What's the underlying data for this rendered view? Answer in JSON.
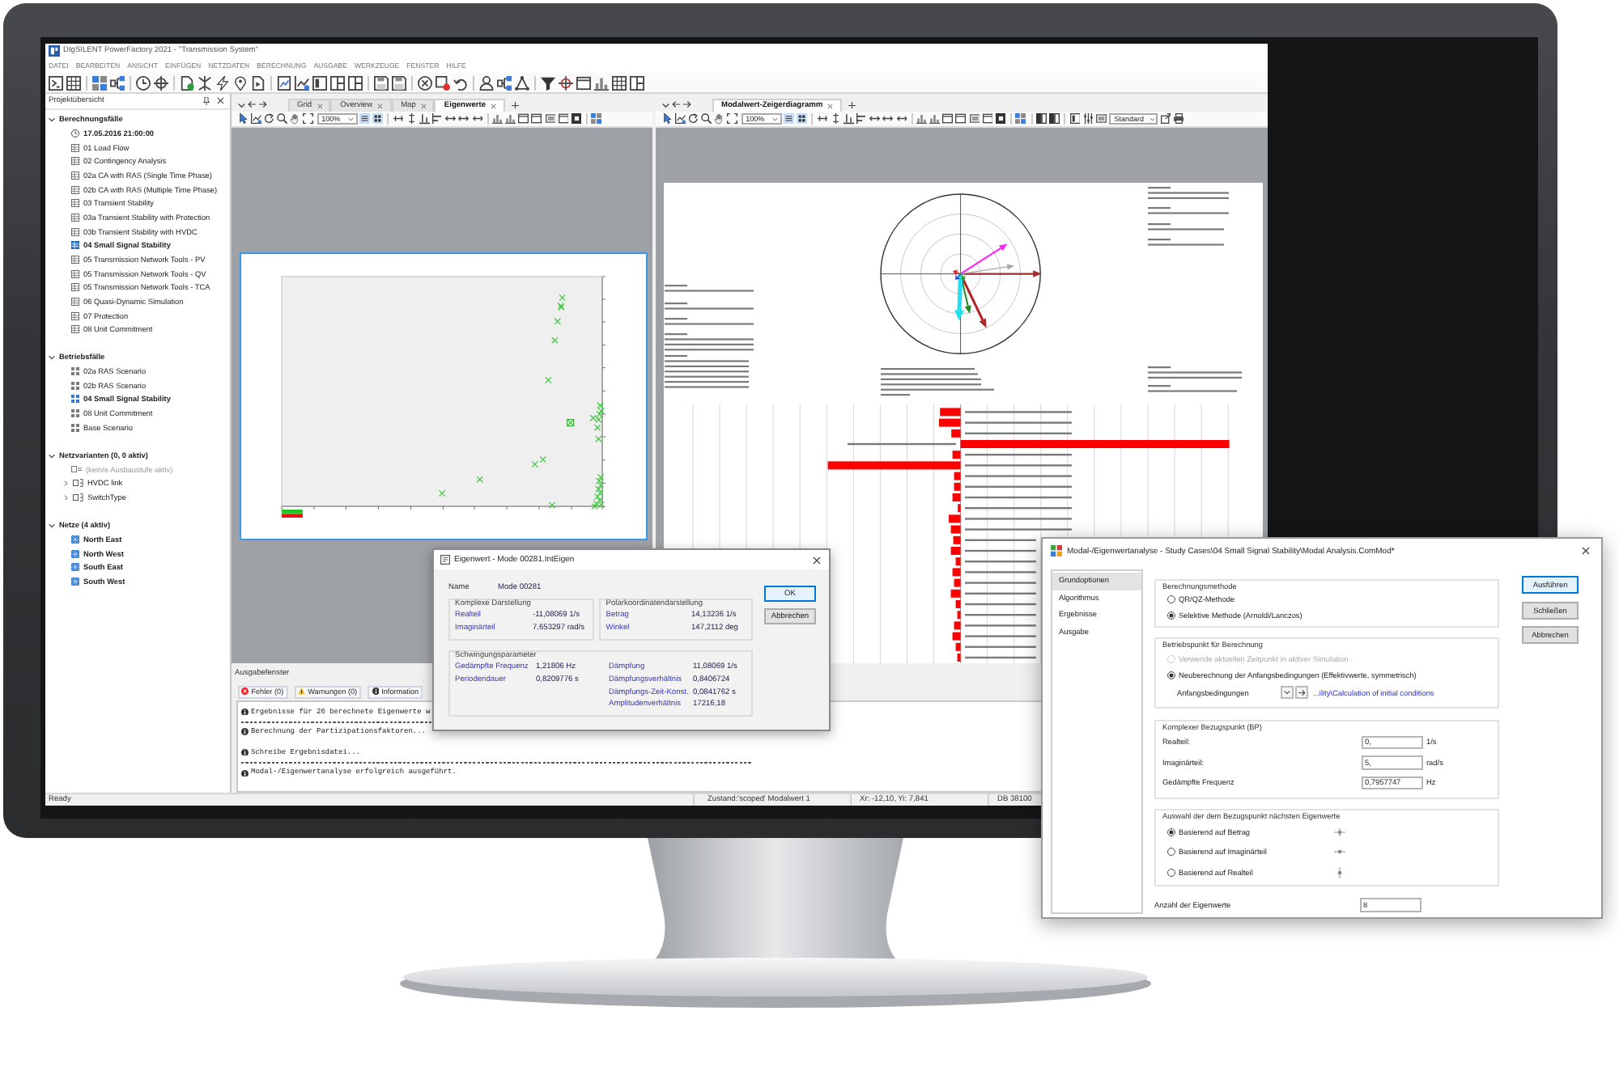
{
  "window": {
    "title": "DIgSILENT PowerFactory 2021 - \"Transmission System\""
  },
  "menu": [
    "DATEI",
    "BEARBEITEN",
    "ANSICHT",
    "EINFÜGEN",
    "NETZDATEN",
    "BERECHNUNG",
    "AUSGABE",
    "WERKZEUGE",
    "FENSTER",
    "HILFE"
  ],
  "project_panel": {
    "title": "Projektübersicht",
    "groups": [
      {
        "label": "Berechnungsfälle",
        "expanded": true,
        "children": [
          {
            "label": "17.05.2016 21:00:00",
            "kind": "time",
            "active": true
          },
          {
            "label": "01 Load Flow",
            "kind": "case",
            "active": false
          },
          {
            "label": "02 Contingency Analysis",
            "kind": "case",
            "active": false
          },
          {
            "label": "02a CA with RAS (Single Time Phase)",
            "kind": "case",
            "active": false
          },
          {
            "label": "02b CA with RAS (Multiple Time Phase)",
            "kind": "case",
            "active": false
          },
          {
            "label": "03 Transient Stability",
            "kind": "case",
            "active": false
          },
          {
            "label": "03a Transient Stability with Protection",
            "kind": "case",
            "active": false
          },
          {
            "label": "03b Transient Stability with HVDC",
            "kind": "case",
            "active": false
          },
          {
            "label": "04 Small Signal Stability",
            "kind": "case",
            "active": true
          },
          {
            "label": "05 Transmission Network Tools - PV",
            "kind": "case",
            "active": false
          },
          {
            "label": "05 Transmission Network Tools - QV",
            "kind": "case",
            "active": false
          },
          {
            "label": "05 Transmission Network Tools - TCA",
            "kind": "case",
            "active": false
          },
          {
            "label": "06 Quasi-Dynamic Simulation",
            "kind": "case",
            "active": false
          },
          {
            "label": "07 Protection",
            "kind": "case",
            "active": false
          },
          {
            "label": "08 Unit Commitment",
            "kind": "case",
            "active": false
          }
        ]
      },
      {
        "label": "Betriebsfälle",
        "expanded": true,
        "children": [
          {
            "label": "02a RAS Scenario",
            "kind": "scenario",
            "active": false
          },
          {
            "label": "02b RAS Scenario",
            "kind": "scenario",
            "active": false
          },
          {
            "label": "04 Small Signal Stability",
            "kind": "scenario",
            "active": true
          },
          {
            "label": "08 Unit Commitment",
            "kind": "scenario",
            "active": false
          },
          {
            "label": "Base Scenario",
            "kind": "scenario",
            "active": false
          }
        ]
      },
      {
        "label": "Netzvarianten (0, 0 aktiv)",
        "expanded": true,
        "children": [
          {
            "label": "(kein/e Ausbaustufe aktiv)",
            "kind": "stage",
            "active": false
          },
          {
            "label": "HVDC link",
            "kind": "variation",
            "active": false,
            "expanded": false
          },
          {
            "label": "SwitchType",
            "kind": "variation",
            "active": false,
            "expanded": false
          }
        ]
      },
      {
        "label": "Netze (4 aktiv)",
        "expanded": true,
        "children": [
          {
            "label": "North East",
            "kind": "grid",
            "active": true
          },
          {
            "label": "North West",
            "kind": "grid",
            "active": true
          },
          {
            "label": "South East",
            "kind": "grid",
            "active": true
          },
          {
            "label": "South West",
            "kind": "grid",
            "active": true
          }
        ]
      }
    ]
  },
  "left_pane": {
    "tabs": [
      {
        "label": "Grid",
        "selected": false
      },
      {
        "label": "Overview",
        "selected": false
      },
      {
        "label": "Map",
        "selected": false
      },
      {
        "label": "Eigenwerte",
        "selected": true
      }
    ],
    "zoom": "100%"
  },
  "right_pane": {
    "tabs": [
      {
        "label": "Modalwert-Zeigerdiagramm",
        "selected": true
      }
    ],
    "zoom": "100%",
    "dropdown": "Standard"
  },
  "output": {
    "title": "Ausgabefenster",
    "filters": [
      {
        "label": "Fehler (0)",
        "kind": "error"
      },
      {
        "label": "Warnungen (0)",
        "kind": "warning"
      },
      {
        "label": "Information",
        "kind": "info"
      }
    ],
    "lines": [
      "Ergebnisse für 26 berechnete Eigenwerte w",
      "Berechnung der Partizipationsfaktoren...",
      "Schreibe Ergebnisdatei...",
      "Modal-/Eigenwertanalyse erfolgreich ausgeführt."
    ]
  },
  "status_bar": {
    "text": "Ready",
    "fields": [
      "Zustand:'scoped' Modalwert 1",
      "Xr: -12,10, Yi: 7,841",
      "DB 38100"
    ]
  },
  "eigen_dialog": {
    "title": "Eigenwert - Mode 00281.IntEigen",
    "name_label": "Name",
    "name": "Mode 00281",
    "top_groups": [
      {
        "title": "Komplexe Darstellung",
        "columns": [
          [
            {
              "label": "Realteil",
              "value": "-11,08069 1/s"
            },
            {
              "label": "Imaginärteil",
              "value": "7,653297 rad/s"
            }
          ]
        ]
      },
      {
        "title": "Polarkoordinatendarstellung",
        "columns": [
          [
            {
              "label": "Betrag",
              "value": "14,13236 1/s"
            },
            {
              "label": "Winkel",
              "value": "147,2112 deg"
            }
          ]
        ]
      }
    ],
    "bottom_group": {
      "title": "Schwingungsparameter",
      "columns": [
        [
          {
            "label": "Gedämpfte Frequenz",
            "value": "1,21806 Hz"
          },
          {
            "label": "Periodendauer",
            "value": "0,8209776 s"
          }
        ],
        [
          {
            "label": "Dämpfung",
            "value": "11,08069 1/s"
          },
          {
            "label": "Dämpfungsverhältnis",
            "value": "0,8406724"
          },
          {
            "label": "Dämpfungs-Zeit-Konst.",
            "value": "0,0841762 s"
          },
          {
            "label": "Amplitudenverhältnis",
            "value": "17216,18"
          }
        ]
      ]
    },
    "buttons": [
      {
        "label": "OK",
        "default": true
      },
      {
        "label": "Abbrechen",
        "default": false
      }
    ]
  },
  "modal_dialog": {
    "title": "Modal-/Eigenwertanalyse - Study Cases\\04 Small Signal Stability\\Modal Analysis.ComMod*",
    "nav": [
      {
        "label": "Grundoptionen",
        "selected": true
      },
      {
        "label": "Algorithmus",
        "selected": false
      },
      {
        "label": "Ergebnisse",
        "selected": false
      },
      {
        "label": "Ausgabe",
        "selected": false
      }
    ],
    "buttons": [
      {
        "label": "Ausführen",
        "default": true
      },
      {
        "label": "Schließen",
        "default": false
      },
      {
        "label": "Abbrechen",
        "default": false
      }
    ],
    "method": {
      "title": "Berechnungsmethode",
      "options": [
        {
          "label": "QR/QZ-Methode",
          "selected": false,
          "disabled": false
        },
        {
          "label": "Selektive Methode (Arnoldi/Lanczos)",
          "selected": true,
          "disabled": false
        }
      ]
    },
    "operating_point": {
      "title": "Betriebspunkt für Berechnung",
      "options": [
        {
          "label": "Verwende aktuellen Zeitpunkt in aktiver Simulation",
          "selected": false,
          "disabled": true
        },
        {
          "label": "Neuberechnung der Anfangsbedingungen (Effektivwerte, symmetrisch)",
          "selected": true,
          "disabled": false
        }
      ],
      "initial_conditions": {
        "label": "Anfangsbedingungen",
        "link": "...ility\\Calculation of initial conditions"
      }
    },
    "reference_point": {
      "title": "Komplexer Bezugspunkt (BP)",
      "fields": [
        {
          "label": "Realteil:",
          "value": "0,",
          "unit": "1/s"
        },
        {
          "label": "Imaginärteil:",
          "value": "5,",
          "unit": "rad/s"
        },
        {
          "label": "Gedämpfte Frequenz",
          "value": "0,7957747",
          "unit": "Hz"
        }
      ]
    },
    "selection": {
      "title": "Auswahl der dem Bezugspunkt nächsten Eigenwerte",
      "options": [
        {
          "label": "Basierend auf Betrag",
          "selected": true
        },
        {
          "label": "Basierend auf Imaginärteil",
          "selected": false
        },
        {
          "label": "Basierend auf Realteil",
          "selected": false
        }
      ]
    },
    "count": {
      "label": "Anzahl der Eigenwerte",
      "value": "8"
    }
  }
}
